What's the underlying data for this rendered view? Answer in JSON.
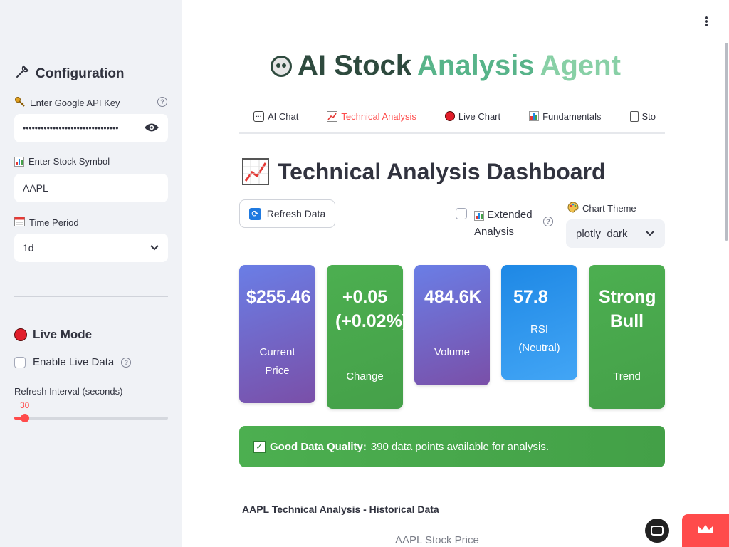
{
  "sidebar": {
    "config_title": "Configuration",
    "api_key_label": "Enter Google API Key",
    "api_key_value": "••••••••••••••••••••••••••••••••",
    "symbol_label": "Enter Stock Symbol",
    "symbol_value": "AAPL",
    "period_label": "Time Period",
    "period_value": "1d",
    "live_title": "Live Mode",
    "live_checkbox_label": "Enable Live Data",
    "refresh_interval_label": "Refresh Interval (seconds)",
    "refresh_interval_value": "30",
    "refresh_interval_fraction": 0.07
  },
  "header": {
    "title_part1": "AI Stock",
    "title_part2": "Analysis",
    "title_part3": "Agent"
  },
  "tabs": [
    {
      "label": "AI Chat",
      "icon": "speech-bubble-icon"
    },
    {
      "label": "Technical Analysis",
      "icon": "chart-increasing-icon"
    },
    {
      "label": "Live Chart",
      "icon": "red-circle-icon"
    },
    {
      "label": "Fundamentals",
      "icon": "bar-chart-icon"
    },
    {
      "label": "Sto",
      "icon": "clipboard-icon"
    }
  ],
  "dashboard": {
    "title": "Technical Analysis Dashboard",
    "refresh_button": "Refresh Data",
    "extended_label": "Extended Analysis",
    "theme_label": "Chart Theme",
    "theme_value": "plotly_dark"
  },
  "metrics": [
    {
      "value": "$255.46",
      "label": "Current Price"
    },
    {
      "value": "+0.05 (+0.02%)",
      "label": "Change"
    },
    {
      "value": "484.6K",
      "label": "Volume"
    },
    {
      "value": "57.8",
      "label": "RSI (Neutral)"
    },
    {
      "value": "Strong Bull",
      "label": "Trend"
    }
  ],
  "quality": {
    "bold": "Good Data Quality:",
    "text": "390 data points available for analysis."
  },
  "historical_title": "AAPL Technical Analysis - Historical Data",
  "chart_title": "AAPL Stock Price",
  "colors": {
    "accent": "#ff4b4b",
    "sidebar_bg": "#f0f2f6",
    "card_purple": "#7a4fa8",
    "card_green": "#4caf50",
    "card_blue": "#2196f3"
  }
}
